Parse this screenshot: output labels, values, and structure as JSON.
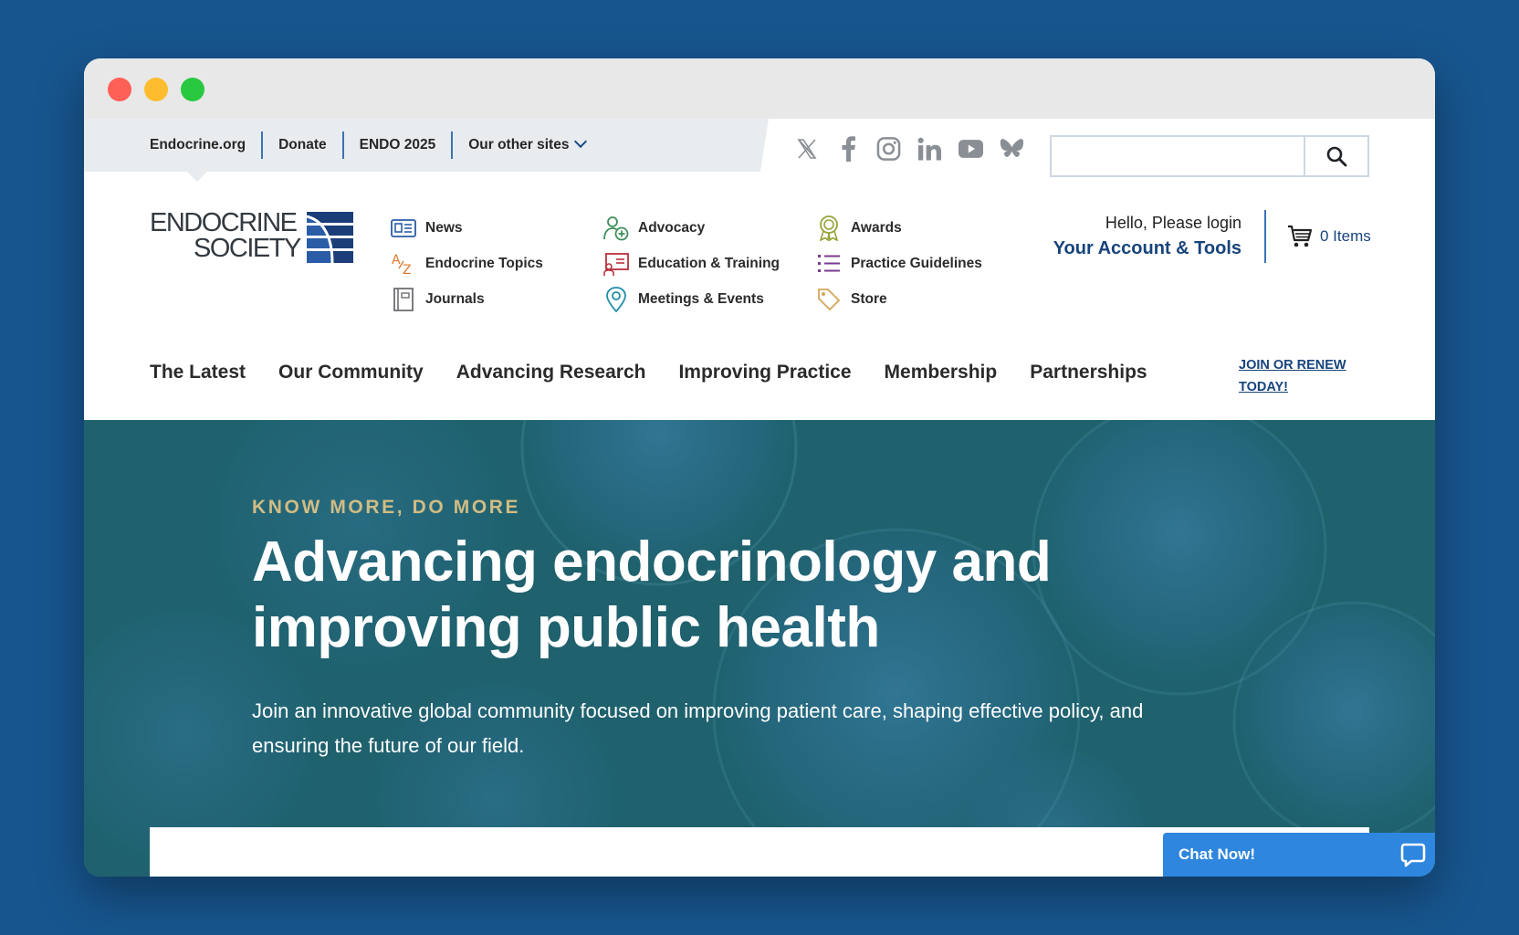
{
  "utility_nav": {
    "links": [
      "Endocrine.org",
      "Donate",
      "ENDO 2025"
    ],
    "other_sites_label": "Our other sites"
  },
  "social_icons": [
    "x-icon",
    "facebook-icon",
    "instagram-icon",
    "linkedin-icon",
    "youtube-icon",
    "bluesky-icon"
  ],
  "search": {
    "placeholder": ""
  },
  "logo": {
    "line1": "ENDOCRINE",
    "line2": "SOCIETY"
  },
  "quick_links": [
    {
      "label": "News",
      "icon": "newspaper-icon"
    },
    {
      "label": "Endocrine Topics",
      "icon": "az-icon"
    },
    {
      "label": "Journals",
      "icon": "journal-icon"
    },
    {
      "label": "Advocacy",
      "icon": "advocacy-icon"
    },
    {
      "label": "Education & Training",
      "icon": "presentation-icon"
    },
    {
      "label": "Meetings & Events",
      "icon": "location-pin-icon"
    },
    {
      "label": "Awards",
      "icon": "award-icon"
    },
    {
      "label": "Practice Guidelines",
      "icon": "list-icon"
    },
    {
      "label": "Store",
      "icon": "tag-icon"
    }
  ],
  "account": {
    "greeting": "Hello, Please login",
    "link": "Your Account & Tools",
    "cart_count": "0 Items"
  },
  "main_nav": [
    "The Latest",
    "Our Community",
    "Advancing Research",
    "Improving Practice",
    "Membership",
    "Partnerships"
  ],
  "join_cta": "JOIN OR RENEW TODAY!",
  "hero": {
    "eyebrow": "KNOW MORE, DO MORE",
    "headline": "Advancing endocrinology and improving public health",
    "subtext": "Join an innovative global community focused on improving patient care, shaping effective policy, and ensuring the future of our field."
  },
  "chat": {
    "label": "Chat Now!"
  },
  "colors": {
    "page_background": "#17558e",
    "brand_blue": "#17447c",
    "hero_teal": "#1f626e",
    "eyebrow_gold": "#d1bc84",
    "chat_blue": "#2e86de"
  }
}
